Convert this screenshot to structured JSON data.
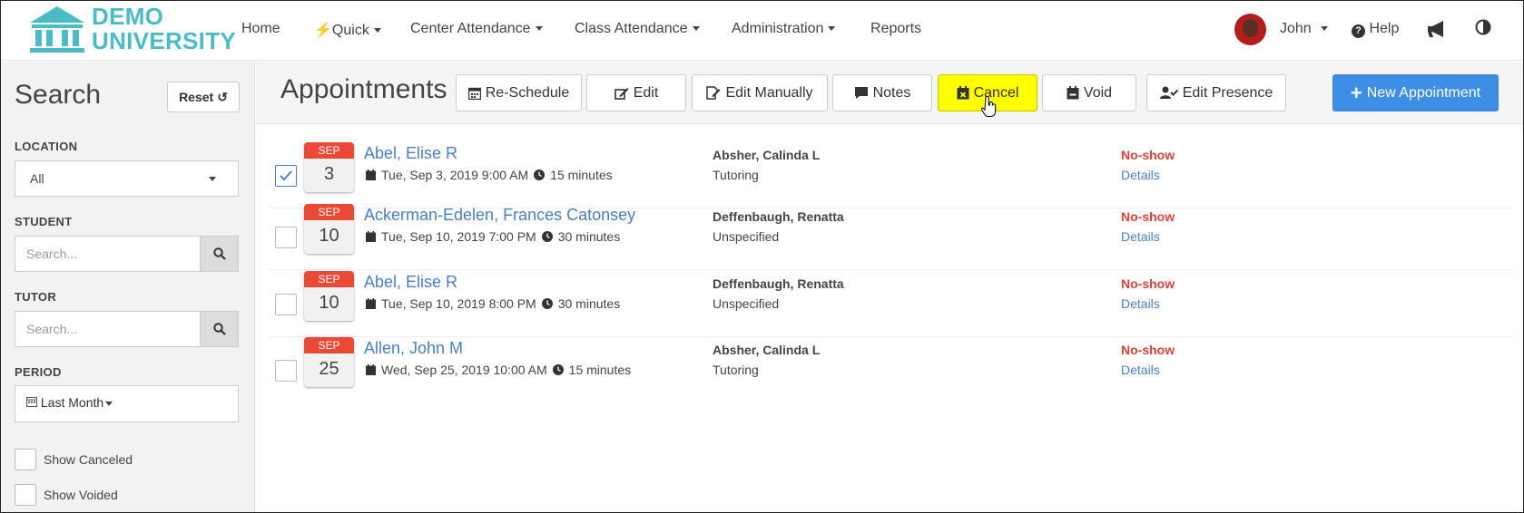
{
  "colors": {
    "accent": "#3f8ee6",
    "highlight": "#ffff00",
    "noshow": "#d9413a",
    "link": "#4a7fc1",
    "calendar": "#ea4a35",
    "brand": "#4bbcc6"
  },
  "brand": {
    "line1": "DEMO",
    "line2": "UNIVERSITY"
  },
  "nav": {
    "home": "Home",
    "quick": "Quick",
    "center_attendance": "Center Attendance",
    "class_attendance": "Class Attendance",
    "administration": "Administration",
    "reports": "Reports",
    "user": "John",
    "help": "Help"
  },
  "sidebar": {
    "title": "Search",
    "reset": "Reset",
    "location_label": "LOCATION",
    "location_value": "All",
    "student_label": "STUDENT",
    "student_placeholder": "Search...",
    "tutor_label": "TUTOR",
    "tutor_placeholder": "Search...",
    "period_label": "PERIOD",
    "period_value": "Last Month",
    "show_canceled": "Show Canceled",
    "show_voided": "Show Voided"
  },
  "toolbar": {
    "title": "Appointments",
    "reschedule": "Re-Schedule",
    "edit": "Edit",
    "edit_manually": "Edit Manually",
    "notes": "Notes",
    "cancel": "Cancel",
    "void": "Void",
    "edit_presence": "Edit Presence",
    "new_appointment": "New Appointment"
  },
  "appointments": [
    {
      "month": "SEP",
      "day": "3",
      "student": "Abel, Elise R",
      "datetime": "Tue, Sep 3, 2019 9:00 AM",
      "duration": "15 minutes",
      "tutor": "Absher, Calinda L",
      "service": "Tutoring",
      "status": "No-show",
      "details": "Details",
      "checked": true
    },
    {
      "month": "SEP",
      "day": "10",
      "student": "Ackerman-Edelen, Frances Catonsey",
      "datetime": "Tue, Sep 10, 2019 7:00 PM",
      "duration": "30 minutes",
      "tutor": "Deffenbaugh, Renatta",
      "service": "Unspecified",
      "status": "No-show",
      "details": "Details",
      "checked": false
    },
    {
      "month": "SEP",
      "day": "10",
      "student": "Abel, Elise R",
      "datetime": "Tue, Sep 10, 2019 8:00 PM",
      "duration": "30 minutes",
      "tutor": "Deffenbaugh, Renatta",
      "service": "Unspecified",
      "status": "No-show",
      "details": "Details",
      "checked": false
    },
    {
      "month": "SEP",
      "day": "25",
      "student": "Allen, John M",
      "datetime": "Wed, Sep 25, 2019 10:00 AM",
      "duration": "15 minutes",
      "tutor": "Absher, Calinda L",
      "service": "Tutoring",
      "status": "No-show",
      "details": "Details",
      "checked": false
    }
  ]
}
